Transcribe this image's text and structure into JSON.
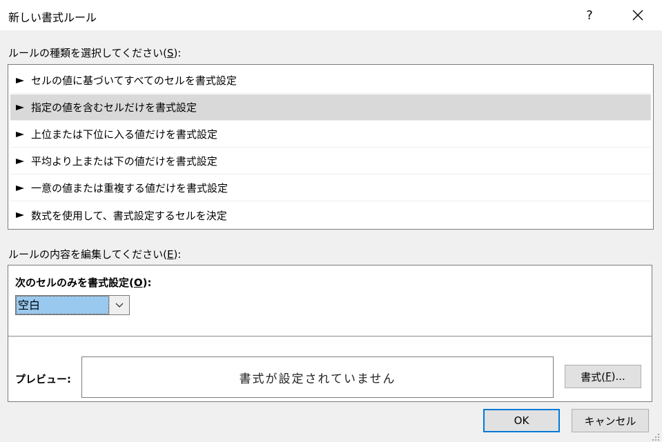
{
  "window": {
    "title": "新しい書式ルール",
    "help_glyph": "?",
    "close_icon": "close-icon"
  },
  "rule_type": {
    "label_prefix": "ルールの種類を選択してください(",
    "label_key": "S",
    "label_suffix": "):",
    "items": [
      {
        "label": "セルの値に基づいてすべてのセルを書式設定",
        "selected": false
      },
      {
        "label": "指定の値を含むセルだけを書式設定",
        "selected": true
      },
      {
        "label": "上位または下位に入る値だけを書式設定",
        "selected": false
      },
      {
        "label": "平均より上または下の値だけを書式設定",
        "selected": false
      },
      {
        "label": "一意の値または重複する値だけを書式設定",
        "selected": false
      },
      {
        "label": "数式を使用して、書式設定するセルを決定",
        "selected": false
      }
    ]
  },
  "edit": {
    "label_prefix": "ルールの内容を編集してください(",
    "label_key": "E",
    "label_suffix": "):",
    "only_prefix": "次のセルのみを書式設定(",
    "only_key": "O",
    "only_suffix": "):",
    "condition_value": "空白",
    "preview_label": "プレビュー:",
    "preview_text": "書式が設定されていません",
    "format_prefix": "書式(",
    "format_key": "F",
    "format_suffix": ")..."
  },
  "buttons": {
    "ok": "OK",
    "cancel": "キャンセル"
  },
  "colors": {
    "selection_highlight": "#99c9ef",
    "selected_item": "#d9d9d9",
    "default_button_border": "#0078d7"
  }
}
